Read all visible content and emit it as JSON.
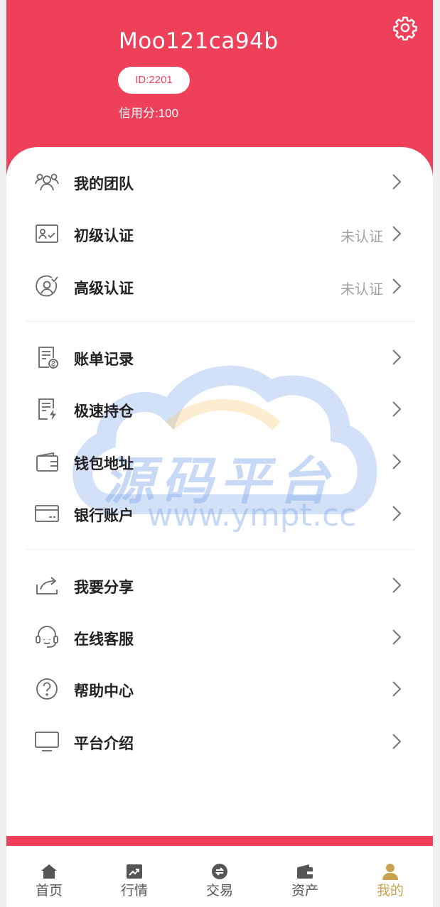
{
  "header": {
    "username": "Moo121ca94b",
    "id_badge": "ID:2201",
    "credit": "信用分:100"
  },
  "colors": {
    "brand": "#ee4059",
    "tab_active": "#c9a24f"
  },
  "menu": {
    "team": {
      "label": "我的团队",
      "icon": "team-icon"
    },
    "basic_verify": {
      "label": "初级认证",
      "status": "未认证",
      "icon": "id-card-icon"
    },
    "advanced_verify": {
      "label": "高级认证",
      "status": "未认证",
      "icon": "verified-user-icon"
    },
    "bills": {
      "label": "账单记录",
      "icon": "bill-icon"
    },
    "fast_position": {
      "label": "极速持仓",
      "icon": "document-bolt-icon"
    },
    "wallet_address": {
      "label": "钱包地址",
      "icon": "wallet-icon"
    },
    "bank_account": {
      "label": "银行账户",
      "icon": "bank-card-icon"
    },
    "share": {
      "label": "我要分享",
      "icon": "share-icon"
    },
    "support": {
      "label": "在线客服",
      "icon": "headset-icon"
    },
    "help": {
      "label": "帮助中心",
      "icon": "help-icon"
    },
    "about": {
      "label": "平台介绍",
      "icon": "monitor-icon"
    }
  },
  "watermark": {
    "line1": "源码平台",
    "line2": "www.ympt.cc"
  },
  "tabbar": {
    "home": "首页",
    "market": "行情",
    "trade": "交易",
    "assets": "资产",
    "mine": "我的"
  }
}
